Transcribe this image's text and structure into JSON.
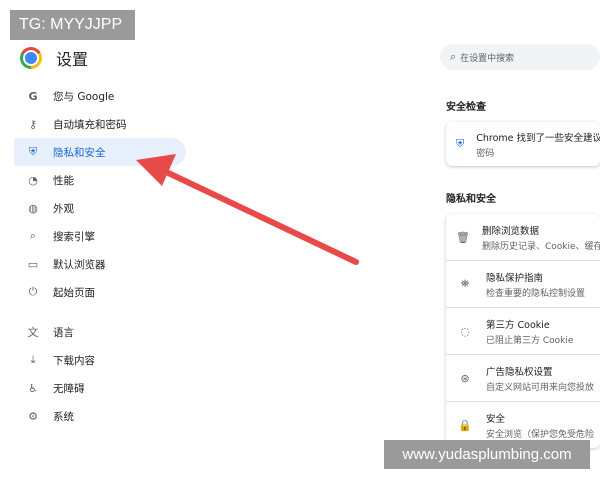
{
  "watermarks": {
    "top_left": "TG: MYYJJPP",
    "bottom_right": "www.yudasplumbing.com"
  },
  "header": {
    "title": "设置",
    "logo_icon": "chrome-logo-icon"
  },
  "search": {
    "placeholder": "在设置中搜索"
  },
  "sidebar": {
    "items": [
      {
        "label": "您与 Google",
        "icon": "google-g-icon",
        "glyph": "G",
        "active": false
      },
      {
        "label": "自动填充和密码",
        "icon": "key-icon",
        "glyph": "⚷",
        "active": false
      },
      {
        "label": "隐私和安全",
        "icon": "shield-icon",
        "glyph": "⛨",
        "active": true
      },
      {
        "label": "性能",
        "icon": "speedometer-icon",
        "glyph": "◔",
        "active": false
      },
      {
        "label": "外观",
        "icon": "palette-icon",
        "glyph": "◍",
        "active": false
      },
      {
        "label": "搜索引擎",
        "icon": "search-icon",
        "glyph": "⌕",
        "active": false
      },
      {
        "label": "默认浏览器",
        "icon": "browser-window-icon",
        "glyph": "▭",
        "active": false
      },
      {
        "label": "起始页面",
        "icon": "power-icon",
        "glyph": "⏻",
        "active": false
      },
      {
        "label": "语言",
        "icon": "translate-icon",
        "glyph": "文",
        "active": false
      },
      {
        "label": "下载内容",
        "icon": "download-icon",
        "glyph": "⤓",
        "active": false
      },
      {
        "label": "无障碍",
        "icon": "accessibility-icon",
        "glyph": "♿",
        "active": false
      },
      {
        "label": "系统",
        "icon": "wrench-icon",
        "glyph": "⚙",
        "active": false
      }
    ]
  },
  "safety_check": {
    "title": "安全检查",
    "item": {
      "title": "Chrome 找到了一些安全建议",
      "subtitle": "密码",
      "icon": "shield-icon"
    }
  },
  "privacy": {
    "title": "隐私和安全",
    "items": [
      {
        "title": "删除浏览数据",
        "subtitle": "删除历史记录、Cookie、缓存",
        "icon": "trash-icon",
        "glyph": "🗑"
      },
      {
        "title": "隐私保护指南",
        "subtitle": "检查重要的隐私控制设置",
        "icon": "privacy-guide-icon",
        "glyph": "⛯"
      },
      {
        "title": "第三方 Cookie",
        "subtitle": "已阻止第三方 Cookie",
        "icon": "cookie-icon",
        "glyph": "◌"
      },
      {
        "title": "广告隐私权设置",
        "subtitle": "自定义网站可用来向您投放",
        "icon": "ad-privacy-icon",
        "glyph": "⊛"
      },
      {
        "title": "安全",
        "subtitle": "安全浏览（保护您免受危险",
        "icon": "lock-icon",
        "glyph": "🔒"
      }
    ]
  },
  "colors": {
    "active_bg": "#e8f0fe",
    "active_fg": "#1967d2",
    "arrow": "#e84a4a"
  }
}
